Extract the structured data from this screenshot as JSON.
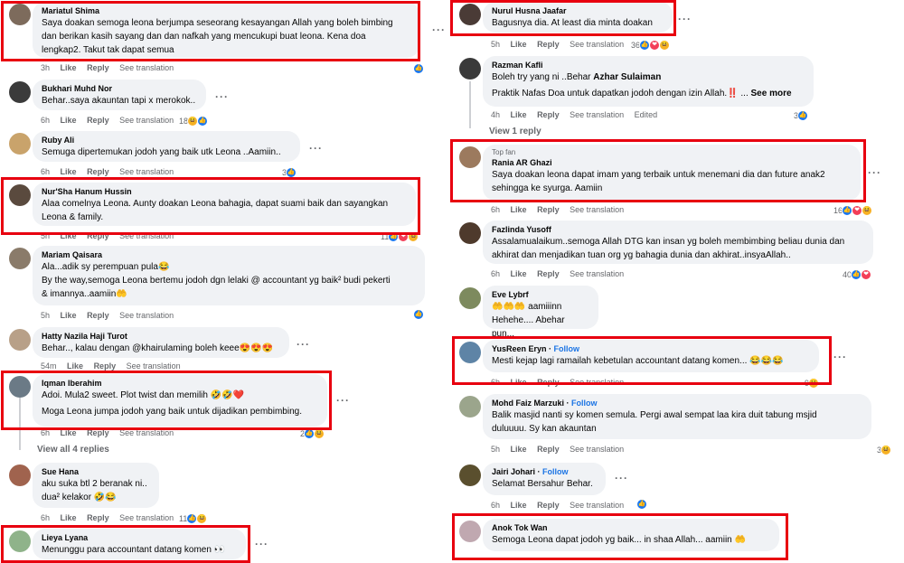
{
  "actions": {
    "like": "Like",
    "reply": "Reply",
    "translate": "See translation",
    "edited": "Edited"
  },
  "left": [
    {
      "name": "Mariatul Shima",
      "text": "Saya doakan semoga leona berjumpa seseorang kesayangan Allah yang boleh bimbing\ndan berikan kasih sayang dan dan nafkah yang mencukupi buat leona. Kena doa\nlengkap2. Takut tak dapat semua",
      "time": "3h",
      "count": ""
    },
    {
      "name": "Bukhari Muhd Nor",
      "text": "Behar..saya akauntan tapi x merokok..",
      "time": "6h",
      "count": "18"
    },
    {
      "name": "Ruby Ali",
      "text": "Semuga dipertemukan jodoh yang baik utk Leona ..Aamiin..",
      "time": "6h",
      "count": "3"
    },
    {
      "name": "Nur'Sha Hanum Hussin",
      "text": "Alaa comelnya Leona. Aunty doakan Leona bahagia, dapat suami baik dan sayangkan\nLeona & family.",
      "time": "5h",
      "count": "11"
    },
    {
      "name": "Mariam Qaisara",
      "text": "Ala...adik sy perempuan pula😂\nBy the way,semoga Leona bertemu jodoh dgn lelaki @ accountant yg baik² budi pekerti\n& imannya..aamiin🤲",
      "time": "5h",
      "count": ""
    },
    {
      "name": "Hatty Nazila Haji Turot",
      "text": "Behar.., kalau dengan @khairulaming boleh keee😍😍😍",
      "time": "54m",
      "count": ""
    },
    {
      "name": "Iqman Iberahim",
      "text": "Adoi. Mula2 sweet. Plot twist dan memilih 🤣🤣❤️",
      "text2": "Moga Leona jumpa jodoh yang baik untuk dijadikan pembimbing.",
      "time": "6h",
      "count": "2"
    },
    {
      "name": "Sue Hana",
      "text": "aku suka btl 2 beranak ni..\ndua² kelakor 🤣😂",
      "time": "6h",
      "count": "11"
    },
    {
      "name": "Lieya Lyana",
      "text": "Menunggu para accountant datang komen 👀",
      "time": "",
      "count": ""
    }
  ],
  "view_replies_left": "View all 4 replies",
  "right": [
    {
      "name": "Nurul Husna Jaafar",
      "text": "Bagusnya dia. At least dia minta doakan",
      "time": "5h",
      "count": "36"
    },
    {
      "name": "Razman Kafli",
      "text": "Boleh try yang ni ..Behar ",
      "mention": "Azhar Sulaiman",
      "text2": "Praktik Nafas Doa untuk dapatkan jodoh dengan izin Allah.‼️ ... ",
      "more": "See more",
      "time": "4h",
      "count": "3"
    },
    {
      "name": "Rania AR Ghazi",
      "top_fan": "Top fan",
      "text": "Saya doakan leona dapat imam yang terbaik untuk menemani dia dan future anak2\nsehingga ke syurga. Aamiin",
      "time": "6h",
      "count": "16"
    },
    {
      "name": "Fazlinda Yusoff",
      "text": "Assalamualaikum..semoga Allah DTG kan insan yg boleh membimbing beliau dunia dan\nakhirat dan menjadikan tuan org yg bahagia dunia dan akhirat..insyaAllah..",
      "time": "6h",
      "count": "40"
    },
    {
      "name": "Eve Lybrf",
      "text": "🤲🤲🤲 aamiiinn\nHehehe.... Abehar pun...",
      "time": "",
      "count": ""
    },
    {
      "name": "YusReen Eryn",
      "follow": "Follow",
      "text": "Mesti kejap lagi ramailah kebetulan accountant datang komen... 😂😂😂",
      "time": "6h",
      "count": "9"
    },
    {
      "name": "Mohd Faiz Marzuki",
      "follow": "Follow",
      "text": "Balik masjid nanti sy komen semula. Pergi awal sempat laa kira duit tabung msjid\nduluuuu. Sy kan akauntan",
      "time": "5h",
      "count": "3"
    },
    {
      "name": "Jairi Johari",
      "follow": "Follow",
      "text": "Selamat Bersahur Behar.",
      "time": "6h",
      "count": ""
    },
    {
      "name": "Anok Tok Wan",
      "text": "Semoga Leona dapat jodoh yg baik... in shaa Allah... aamiin 🤲",
      "time": "",
      "count": ""
    }
  ],
  "view_replies_right": "View 1 reply",
  "icons": {
    "like": "👍",
    "love": "❤",
    "haha": "😆",
    "more": "•••"
  },
  "colors": {
    "highlight": "#e8000f",
    "bubble": "#f0f2f5",
    "link": "#1b74e4",
    "meta": "#65676b"
  }
}
